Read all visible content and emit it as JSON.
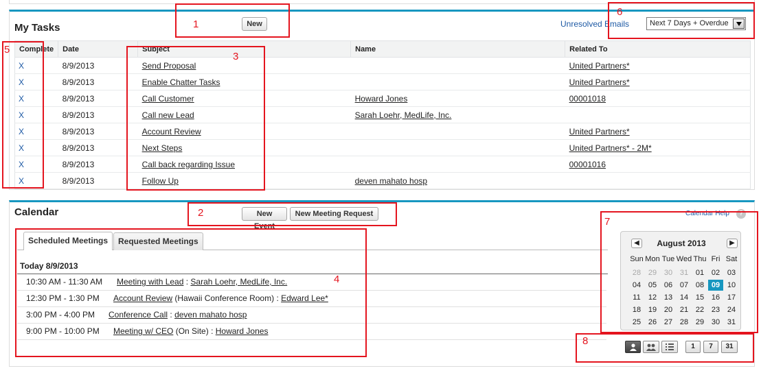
{
  "tasks": {
    "title": "My Tasks",
    "new_button": "New",
    "unresolved_emails": "Unresolved Emails",
    "filter_value": "Next 7 Days + Overdue",
    "columns": [
      "Complete",
      "Date",
      "Subject",
      "Name",
      "Related To"
    ],
    "rows": [
      {
        "complete": "X",
        "date": "8/9/2013",
        "subject": "Send Proposal",
        "name": "",
        "related": "United Partners*"
      },
      {
        "complete": "X",
        "date": "8/9/2013",
        "subject": "Enable Chatter Tasks",
        "name": "",
        "related": "United Partners*"
      },
      {
        "complete": "X",
        "date": "8/9/2013",
        "subject": "Call Customer",
        "name": "Howard Jones",
        "related": "00001018"
      },
      {
        "complete": "X",
        "date": "8/9/2013",
        "subject": "Call new Lead",
        "name": "Sarah Loehr, MedLife, Inc.",
        "related": ""
      },
      {
        "complete": "X",
        "date": "8/9/2013",
        "subject": "Account Review",
        "name": "",
        "related": "United Partners*"
      },
      {
        "complete": "X",
        "date": "8/9/2013",
        "subject": "Next Steps",
        "name": "",
        "related": "United Partners* - 2M*"
      },
      {
        "complete": "X",
        "date": "8/9/2013",
        "subject": "Call back regarding Issue",
        "name": "",
        "related": "00001016"
      },
      {
        "complete": "X",
        "date": "8/9/2013",
        "subject": "Follow Up",
        "name": "deven mahato hosp",
        "related": ""
      }
    ]
  },
  "calendar": {
    "title": "Calendar",
    "new_event_button": "New Event",
    "new_meeting_button": "New Meeting Request",
    "help_link": "Calendar Help",
    "help_icon": "?",
    "tabs": [
      "Scheduled Meetings",
      "Requested Meetings"
    ],
    "day_heading": "Today 8/9/2013",
    "events": [
      {
        "time": "10:30 AM - 11:30 AM",
        "subject": "Meeting with Lead",
        "location": "",
        "sep": " : ",
        "who": "Sarah Loehr, MedLife, Inc."
      },
      {
        "time": "12:30 PM - 1:30 PM",
        "subject": "Account Review",
        "location": " (Hawaii Conference Room)",
        "sep": " : ",
        "who": "Edward Lee*"
      },
      {
        "time": "3:00 PM - 4:00 PM",
        "subject": "Conference Call",
        "location": "",
        "sep": " : ",
        "who": "deven mahato hosp"
      },
      {
        "time": "9:00 PM - 10:00 PM",
        "subject": "Meeting w/ CEO",
        "location": " (On Site)",
        "sep": " : ",
        "who": "Howard Jones"
      }
    ],
    "mini_calendar": {
      "month_label": "August 2013",
      "weekdays": [
        "Sun",
        "Mon",
        "Tue",
        "Wed",
        "Thu",
        "Fri",
        "Sat"
      ],
      "weeks": [
        [
          "28",
          "29",
          "30",
          "31",
          "01",
          "02",
          "03"
        ],
        [
          "04",
          "05",
          "06",
          "07",
          "08",
          "09",
          "10"
        ],
        [
          "11",
          "12",
          "13",
          "14",
          "15",
          "16",
          "17"
        ],
        [
          "18",
          "19",
          "20",
          "21",
          "22",
          "23",
          "24"
        ],
        [
          "25",
          "26",
          "27",
          "28",
          "29",
          "30",
          "31"
        ]
      ],
      "today": "09",
      "today_color": "#1797c0",
      "muted_days": [
        "28",
        "29",
        "30",
        "31"
      ],
      "prev_icon": "chevron-left-icon",
      "next_icon": "chevron-right-icon"
    },
    "view_buttons": {
      "icons": [
        "single-user-icon",
        "multi-user-icon",
        "list-view-icon"
      ],
      "day_label": "1",
      "week_label": "7",
      "month_label": "31"
    }
  },
  "annotations": {
    "color": "#e4141e",
    "numbers": [
      "1",
      "2",
      "3",
      "4",
      "5",
      "6",
      "7",
      "8"
    ]
  }
}
